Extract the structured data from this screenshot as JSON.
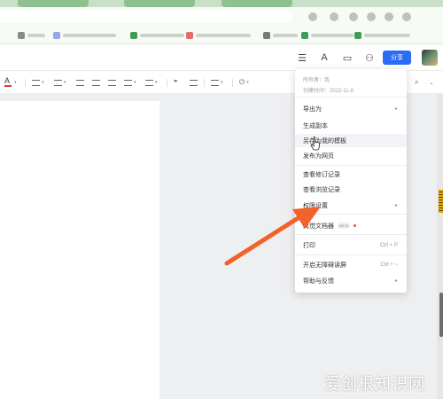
{
  "header": {
    "share_label": "分享"
  },
  "menu": {
    "meta": {
      "owner_label": "所有者：",
      "owner_value": "我",
      "created_label": "创建时间：",
      "created_value": "2022-11-8"
    },
    "items": [
      {
        "label": "导出为",
        "has_submenu": true
      },
      {
        "label": "生成副本"
      },
      {
        "label": "另存为我的模板"
      },
      {
        "label": "发布为网页"
      },
      {
        "label": "查看修订记录"
      },
      {
        "label": "查看浏览记录"
      },
      {
        "label": "权限设置",
        "has_submenu": true
      },
      {
        "label": "简觉文档器",
        "badge": "BETA",
        "badge_dot_color": "#f04a3c"
      },
      {
        "label": "打印",
        "shortcut": "Ctrl + P"
      },
      {
        "label": "开启无障碍读屏",
        "shortcut": "Ctrl + ~"
      },
      {
        "label": "帮助与反馈",
        "has_submenu": true
      }
    ]
  },
  "annotation": {
    "arrow_color": "#f2622b"
  },
  "watermark": {
    "text": "爱创根知识网"
  }
}
